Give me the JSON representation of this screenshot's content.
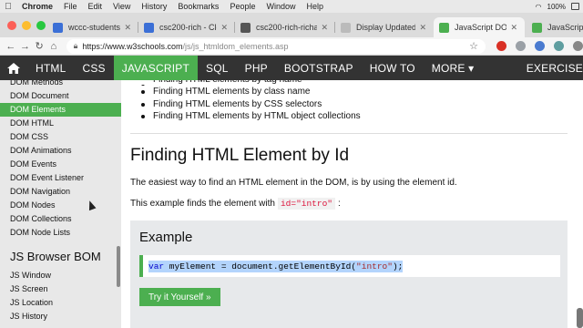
{
  "menubar": {
    "items": [
      "Chrome",
      "File",
      "Edit",
      "View",
      "History",
      "Bookmarks",
      "People",
      "Window",
      "Help"
    ],
    "battery": "100%"
  },
  "tabs": [
    {
      "title": "wccc-students",
      "favicon_color": "#3b6fd6"
    },
    {
      "title": "csc200-rich - Cloud",
      "favicon_color": "#3b6fd6"
    },
    {
      "title": "csc200-rich-richar",
      "favicon_color": "#555555"
    },
    {
      "title": "Display Updated Da",
      "favicon_color": "#bbbbbb"
    },
    {
      "title": "JavaScript DOM Ele",
      "favicon_color": "#4caf50"
    },
    {
      "title": "JavaScript Fo",
      "favicon_color": "#4caf50"
    }
  ],
  "address": {
    "host": "https://www.w3schools.com",
    "path": "/js/js_htmldom_elements.asp"
  },
  "topnav": [
    "HTML",
    "CSS",
    "JAVASCRIPT",
    "SQL",
    "PHP",
    "BOOTSTRAP",
    "HOW TO",
    "MORE ▾",
    "EXERCISE"
  ],
  "sidebar": {
    "cut_item": "DOM Methods",
    "items": [
      "DOM Document",
      "DOM Elements",
      "DOM HTML",
      "DOM CSS",
      "DOM Animations",
      "DOM Events",
      "DOM Event Listener",
      "DOM Navigation",
      "DOM Nodes",
      "DOM Collections",
      "DOM Node Lists"
    ],
    "section_heading": "JS Browser BOM",
    "bom_items": [
      "JS Window",
      "JS Screen",
      "JS Location",
      "JS History"
    ]
  },
  "content": {
    "bullets_cut": "Finding HTML elements by tag name",
    "bullets": [
      "Finding HTML elements by class name",
      "Finding HTML elements by CSS selectors",
      "Finding HTML elements by HTML object collections"
    ],
    "heading": "Finding HTML Element by Id",
    "p1": "The easiest way to find an HTML element in the DOM, is by using the element id.",
    "p2_before": "This example finds the element with",
    "p2_code": "id=\"intro\"",
    "p2_after": ":",
    "example_title": "Example",
    "code_kw": "var",
    "code_mid": " myElement = document.getElementById(",
    "code_str": "\"intro\"",
    "code_end": ");",
    "button": "Try it Yourself »"
  }
}
